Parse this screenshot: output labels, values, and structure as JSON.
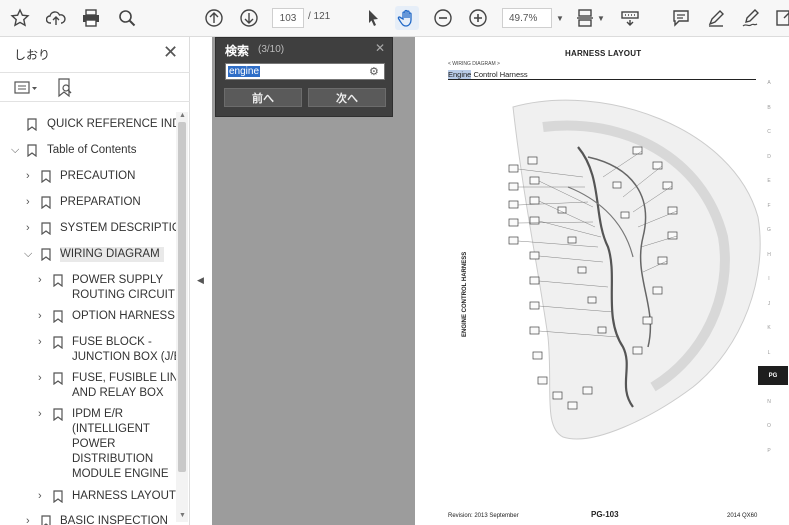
{
  "toolbar": {
    "page_current": "103",
    "page_total": "/ 121",
    "zoom": "49.7%"
  },
  "sidebar": {
    "title": "しおり",
    "items": [
      {
        "label": "QUICK REFERENCE INDEX"
      },
      {
        "label": "Table of Contents"
      },
      {
        "label": "PRECAUTION"
      },
      {
        "label": "PREPARATION"
      },
      {
        "label": "SYSTEM DESCRIPTION"
      },
      {
        "label": "WIRING DIAGRAM"
      },
      {
        "line1": "POWER SUPPLY",
        "line2": "ROUTING CIRCUIT"
      },
      {
        "label": "OPTION HARNESS"
      },
      {
        "line1": "FUSE BLOCK -",
        "line2": "JUNCTION BOX (J/B)"
      },
      {
        "line1": "FUSE, FUSIBLE LINK",
        "line2": "AND RELAY BOX"
      },
      {
        "line1": "IPDM E/R",
        "line2": "(INTELLIGENT",
        "line3": "POWER",
        "line4": "DISTRIBUTION",
        "line5": "MODULE ENGINE"
      },
      {
        "label": "HARNESS LAYOUT"
      },
      {
        "label": "BASIC INSPECTION"
      }
    ]
  },
  "search": {
    "title": "検索",
    "count": "(3/10)",
    "query": "engine",
    "prev_label": "前へ",
    "next_label": "次へ"
  },
  "page": {
    "title": "HARNESS LAYOUT",
    "section": "< WIRING DIAGRAM >",
    "subtitle_match": "Engine",
    "subtitle_rest": " Control Harness",
    "vertical_label": "ENGINE CONTROL HARNESS",
    "footer_left": "Revision: 2013 September",
    "footer_page": "PG-103",
    "footer_right": "2014 QX60",
    "index_letters": [
      "A",
      "B",
      "C",
      "D",
      "E",
      "F",
      "G",
      "H",
      "I",
      "J",
      "K",
      "L",
      "PG",
      "N",
      "O",
      "P"
    ],
    "active_index": "PG"
  },
  "colors": {
    "selection": "#2f6ec7",
    "highlight": "#b8cbe8",
    "viewer_bg": "#9c9c9c"
  }
}
